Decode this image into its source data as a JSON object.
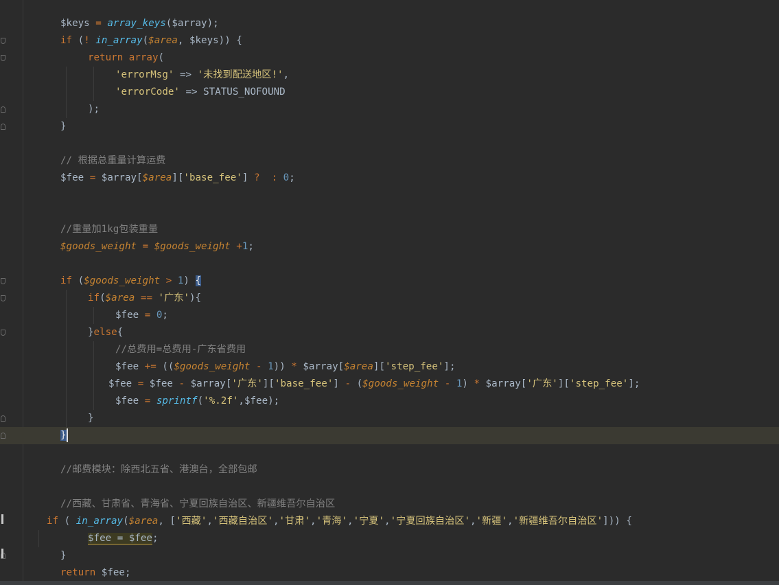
{
  "lines": [
    {
      "tokens": [
        [
          "var",
          "$keys"
        ],
        [
          "var",
          " "
        ],
        [
          "op",
          "="
        ],
        [
          "var",
          " "
        ],
        [
          "fn",
          "array_keys"
        ],
        [
          "var",
          "($array);"
        ]
      ]
    },
    {
      "tokens": [
        [
          "kw",
          "if"
        ],
        [
          "var",
          " ("
        ],
        [
          "op",
          "!"
        ],
        [
          "var",
          " "
        ],
        [
          "fn",
          "in_array"
        ],
        [
          "var",
          "("
        ],
        [
          "ivar",
          "$area"
        ],
        [
          "var",
          ", $keys)) {"
        ]
      ]
    },
    {
      "tokens": [
        [
          "kw",
          "return"
        ],
        [
          "var",
          " "
        ],
        [
          "kw",
          "array"
        ],
        [
          "var",
          "("
        ]
      ]
    },
    {
      "tokens": [
        [
          "str",
          "'errorMsg'"
        ],
        [
          "var",
          " => "
        ],
        [
          "str",
          "'未找到配送地区!'"
        ],
        [
          "var",
          ","
        ]
      ]
    },
    {
      "tokens": [
        [
          "str",
          "'errorCode'"
        ],
        [
          "var",
          " => STATUS_NOFOUND"
        ]
      ]
    },
    {
      "tokens": [
        [
          "var",
          ");"
        ]
      ]
    },
    {
      "tokens": [
        [
          "var",
          "}"
        ]
      ]
    },
    {
      "tokens": []
    },
    {
      "tokens": [
        [
          "cmt",
          "// 根据总重量计算运费"
        ]
      ]
    },
    {
      "tokens": [
        [
          "var",
          "$fee "
        ],
        [
          "op",
          "="
        ],
        [
          "var",
          " $array["
        ],
        [
          "ivar",
          "$area"
        ],
        [
          "var",
          "]["
        ],
        [
          "str",
          "'base_fee'"
        ],
        [
          "var",
          "] "
        ],
        [
          "op",
          "?"
        ],
        [
          "var",
          "  "
        ],
        [
          "op",
          ":"
        ],
        [
          "var",
          " "
        ],
        [
          "num",
          "0"
        ],
        [
          "var",
          ";"
        ]
      ]
    },
    {
      "tokens": []
    },
    {
      "tokens": []
    },
    {
      "tokens": [
        [
          "cmt",
          "//重量加1kg包装重量"
        ]
      ]
    },
    {
      "tokens": [
        [
          "ivar",
          "$goods_weight"
        ],
        [
          "var",
          " "
        ],
        [
          "op",
          "="
        ],
        [
          "var",
          " "
        ],
        [
          "ivar",
          "$goods_weight"
        ],
        [
          "var",
          " "
        ],
        [
          "op",
          "+"
        ],
        [
          "num",
          "1"
        ],
        [
          "var",
          ";"
        ]
      ]
    },
    {
      "tokens": []
    },
    {
      "tokens": [
        [
          "kw",
          "if"
        ],
        [
          "var",
          " ("
        ],
        [
          "ivar",
          "$goods_weight"
        ],
        [
          "var",
          " "
        ],
        [
          "op",
          ">"
        ],
        [
          "var",
          " "
        ],
        [
          "num",
          "1"
        ],
        [
          "var",
          ") "
        ],
        [
          "hl",
          "{"
        ]
      ]
    },
    {
      "tokens": [
        [
          "kw",
          "if"
        ],
        [
          "var",
          "("
        ],
        [
          "ivar",
          "$area"
        ],
        [
          "var",
          " "
        ],
        [
          "op",
          "=="
        ],
        [
          "var",
          " "
        ],
        [
          "str",
          "'广东'"
        ],
        [
          "var",
          "){"
        ]
      ]
    },
    {
      "tokens": [
        [
          "var",
          "$fee "
        ],
        [
          "op",
          "="
        ],
        [
          "var",
          " "
        ],
        [
          "num",
          "0"
        ],
        [
          "var",
          ";"
        ]
      ]
    },
    {
      "tokens": [
        [
          "var",
          "}"
        ],
        [
          "kw",
          "else"
        ],
        [
          "var",
          "{"
        ]
      ]
    },
    {
      "tokens": [
        [
          "cmt",
          "//总费用=总费用-广东省费用"
        ]
      ]
    },
    {
      "tokens": [
        [
          "var",
          "$fee "
        ],
        [
          "op",
          "+="
        ],
        [
          "var",
          " (("
        ],
        [
          "ivar",
          "$goods_weight"
        ],
        [
          "var",
          " "
        ],
        [
          "op",
          "-"
        ],
        [
          "var",
          " "
        ],
        [
          "num",
          "1"
        ],
        [
          "var",
          ")) "
        ],
        [
          "op",
          "*"
        ],
        [
          "var",
          " $array["
        ],
        [
          "ivar",
          "$area"
        ],
        [
          "var",
          "]["
        ],
        [
          "str",
          "'step_fee'"
        ],
        [
          "var",
          "];"
        ]
      ]
    },
    {
      "tokens": [
        [
          "var",
          "$fee "
        ],
        [
          "op",
          "="
        ],
        [
          "var",
          " $fee "
        ],
        [
          "op",
          "-"
        ],
        [
          "var",
          " $array["
        ],
        [
          "str",
          "'广东'"
        ],
        [
          "var",
          "]["
        ],
        [
          "str",
          "'base_fee'"
        ],
        [
          "var",
          "] "
        ],
        [
          "op",
          "-"
        ],
        [
          "var",
          " ("
        ],
        [
          "ivar",
          "$goods_weight"
        ],
        [
          "var",
          " "
        ],
        [
          "op",
          "-"
        ],
        [
          "var",
          " "
        ],
        [
          "num",
          "1"
        ],
        [
          "var",
          ") "
        ],
        [
          "op",
          "*"
        ],
        [
          "var",
          " $array["
        ],
        [
          "str",
          "'广东'"
        ],
        [
          "var",
          "]["
        ],
        [
          "str",
          "'step_fee'"
        ],
        [
          "var",
          "];"
        ]
      ]
    },
    {
      "tokens": [
        [
          "var",
          "$fee "
        ],
        [
          "op",
          "="
        ],
        [
          "var",
          " "
        ],
        [
          "fn",
          "sprintf"
        ],
        [
          "var",
          "("
        ],
        [
          "str",
          "'%.2f'"
        ],
        [
          "var",
          ",$fee);"
        ]
      ]
    },
    {
      "tokens": [
        [
          "var",
          "}"
        ]
      ]
    },
    {
      "tokens": [
        [
          "hl",
          "}"
        ]
      ]
    },
    {
      "tokens": []
    },
    {
      "tokens": [
        [
          "cmt",
          "//邮费模块：除西北五省、港澳台，全部包邮"
        ]
      ]
    },
    {
      "tokens": []
    },
    {
      "tokens": [
        [
          "cmt",
          "//西藏、甘肃省、青海省、宁夏回族自治区、新疆维吾尔自治区"
        ]
      ]
    },
    {
      "tokens": [
        [
          "kw",
          "if"
        ],
        [
          "var",
          " ( "
        ],
        [
          "fn",
          "in_array"
        ],
        [
          "var",
          "("
        ],
        [
          "ivar",
          "$area"
        ],
        [
          "var",
          ", ["
        ],
        [
          "str",
          "'西藏'"
        ],
        [
          "var",
          ","
        ],
        [
          "str",
          "'西藏自治区'"
        ],
        [
          "var",
          ","
        ],
        [
          "str",
          "'甘肃'"
        ],
        [
          "var",
          ","
        ],
        [
          "str",
          "'青海'"
        ],
        [
          "var",
          ","
        ],
        [
          "str",
          "'宁夏'"
        ],
        [
          "var",
          ","
        ],
        [
          "str",
          "'宁夏回族自治区'"
        ],
        [
          "var",
          ","
        ],
        [
          "str",
          "'新疆'"
        ],
        [
          "var",
          ","
        ],
        [
          "str",
          "'新疆维吾尔自治区'"
        ],
        [
          "var",
          "])) {"
        ]
      ]
    },
    {
      "tokens": [
        [
          "word",
          "$fee = $fee"
        ],
        [
          "var",
          ";"
        ]
      ]
    },
    {
      "tokens": [
        [
          "var",
          "}"
        ]
      ]
    },
    {
      "tokens": [
        [
          "kw",
          "return"
        ],
        [
          "var",
          " $fee;"
        ]
      ]
    }
  ]
}
